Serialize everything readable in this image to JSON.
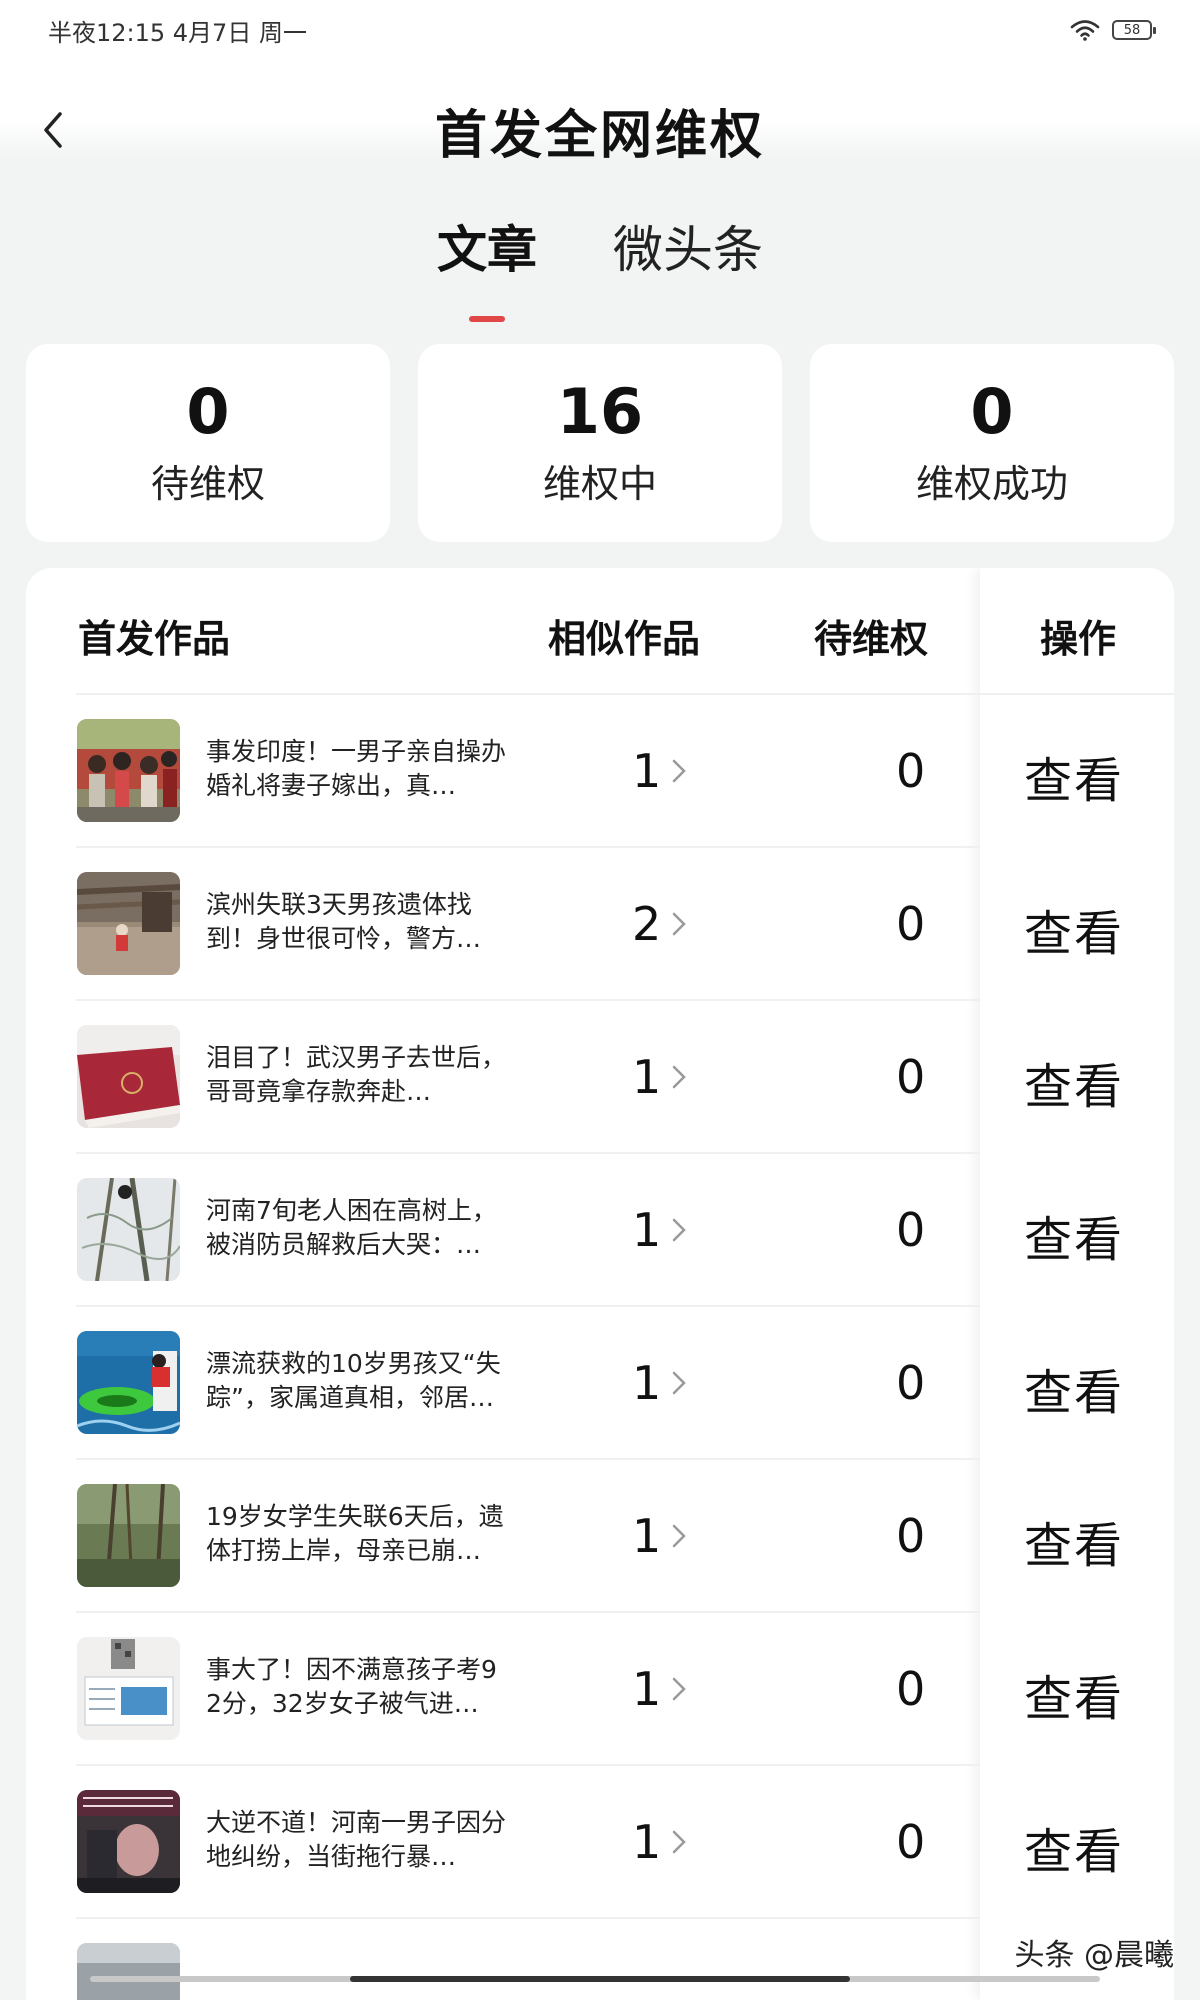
{
  "status_bar": {
    "time_text": "半夜12:15 4月7日 周一",
    "battery_level": "58"
  },
  "header": {
    "title": "首发全网维权"
  },
  "tabs": [
    {
      "label": "文章",
      "active": true
    },
    {
      "label": "微头条",
      "active": false
    }
  ],
  "stats": [
    {
      "value": "0",
      "label": "待维权"
    },
    {
      "value": "16",
      "label": "维权中"
    },
    {
      "value": "0",
      "label": "维权成功"
    }
  ],
  "table": {
    "headers": {
      "original": "首发作品",
      "similar": "相似作品",
      "pending": "待维权",
      "action": "操作"
    },
    "rows": [
      {
        "title": "事发印度！一男子亲自操办婚礼将妻子嫁出，真…",
        "similar": "1",
        "pending": "0",
        "action": "查看"
      },
      {
        "title": "滨州失联3天男孩遗体找到！身世很可怜，警方…",
        "similar": "2",
        "pending": "0",
        "action": "查看"
      },
      {
        "title": "泪目了！武汉男子去世后，哥哥竟拿存款奔赴…",
        "similar": "1",
        "pending": "0",
        "action": "查看"
      },
      {
        "title": "河南7旬老人困在高树上，被消防员解救后大哭：…",
        "similar": "1",
        "pending": "0",
        "action": "查看"
      },
      {
        "title": "漂流获救的10岁男孩又“失踪”，家属道真相，邻居…",
        "similar": "1",
        "pending": "0",
        "action": "查看"
      },
      {
        "title": "19岁女学生失联6天后，遗体打捞上岸，母亲已崩…",
        "similar": "1",
        "pending": "0",
        "action": "查看"
      },
      {
        "title": "事大了！因不满意孩子考92分，32岁女子被气进…",
        "similar": "1",
        "pending": "0",
        "action": "查看"
      },
      {
        "title": "大逆不道！河南一男子因分地纠纷，当街拖行暴…",
        "similar": "1",
        "pending": "0",
        "action": "查看"
      }
    ]
  },
  "watermark": "头条 @晨曦",
  "colors": {
    "accent": "#e04848",
    "card_bg": "#ffffff",
    "page_bg": "#f3f5f5"
  }
}
